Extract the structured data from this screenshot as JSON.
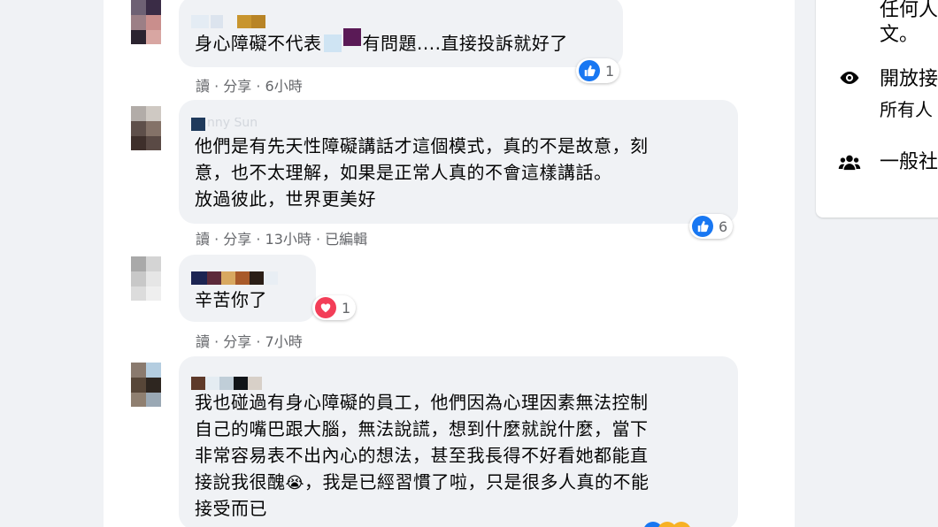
{
  "comments": [
    {
      "name_hint": "",
      "lines": [
        "身心障礙不代表",
        "有問題....直接投訴就好了"
      ],
      "meta": "讀 · 分享 · 6小時",
      "reaction": {
        "icon": "like-icon",
        "count": "1"
      }
    },
    {
      "name_hint": "nny Sun",
      "lines": [
        "他們是有先天性障礙講話才這個模式，真的不是故意，刻",
        "意，也不太理解，如果是正常人真的不會這樣講話。",
        "放過彼此，世界更美好"
      ],
      "meta": "讀 · 分享 · 13小時 · 已編輯",
      "reaction": {
        "icon": "like-icon",
        "count": "6"
      }
    },
    {
      "name_hint": "",
      "lines": [
        "辛苦你了"
      ],
      "meta": "讀 · 分享 · 7小時",
      "reaction": {
        "icon": "love-icon",
        "count": "1"
      }
    },
    {
      "name_hint": "",
      "lines": [
        "我也碰過有身心障礙的員工，他們因為心理因素無法控制",
        "自己的嘴巴跟大腦，無法說謊，想到什麼就說什麼，當下",
        "非常容易表不出內心的想法，甚至我長得不好看她都能直",
        "接說我很醜",
        "，我是已經習慣了啦，只是很多人真的不能",
        "接受而已"
      ],
      "emoji": "😭"
    }
  ],
  "sidebar": {
    "line1": "任何人",
    "line2": "文。",
    "open_title": "開放接",
    "open_sub": "所有人",
    "general": "一般社"
  },
  "colors": {
    "like_blue": "#1877f2",
    "love_red": "#f33e58",
    "meta_gray": "#65676b",
    "bubble_bg": "#f0f2f5"
  }
}
